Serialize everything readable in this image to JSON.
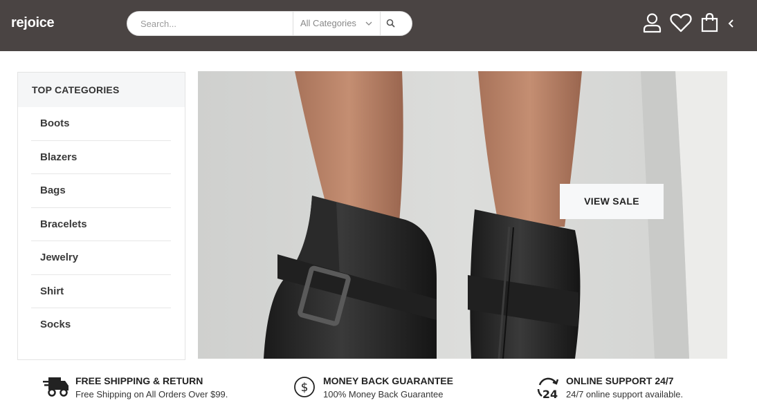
{
  "header": {
    "logo": "rejoice",
    "search_placeholder": "Search...",
    "category_select": "All Categories"
  },
  "sidebar": {
    "title": "TOP CATEGORIES",
    "items": [
      {
        "label": "Boots"
      },
      {
        "label": "Blazers"
      },
      {
        "label": "Bags"
      },
      {
        "label": "Bracelets"
      },
      {
        "label": "Jewelry"
      },
      {
        "label": "Shirt"
      },
      {
        "label": "Socks"
      }
    ]
  },
  "hero": {
    "cta_label": "VIEW SALE"
  },
  "features": [
    {
      "icon": "truck-icon",
      "title": "FREE SHIPPING & RETURN",
      "subtitle": "Free Shipping on All Orders Over $99."
    },
    {
      "icon": "dollar-circle-icon",
      "title": "MONEY BACK GUARANTEE",
      "subtitle": "100% Money Back Guarantee"
    },
    {
      "icon": "support-24-icon",
      "title": "ONLINE SUPPORT 24/7",
      "subtitle": "24/7 online support available."
    }
  ],
  "colors": {
    "header_bg": "#4a4443",
    "sidebar_head_bg": "#f5f6f7",
    "cta_bg": "#f7f8f9"
  }
}
